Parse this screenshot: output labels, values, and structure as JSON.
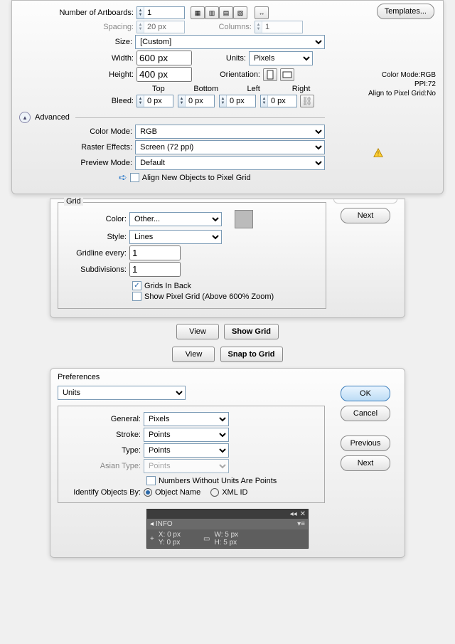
{
  "new_doc": {
    "number_of_artboards_label": "Number of Artboards:",
    "number_of_artboards_value": "1",
    "spacing_label": "Spacing:",
    "spacing_value": "20 px",
    "columns_label": "Columns:",
    "columns_value": "1",
    "size_label": "Size:",
    "size_value": "[Custom]",
    "width_label": "Width:",
    "width_value": "600 px",
    "units_label": "Units:",
    "units_value": "Pixels",
    "height_label": "Height:",
    "height_value": "400 px",
    "orientation_label": "Orientation:",
    "bleed_label": "Bleed:",
    "bleed_top_label": "Top",
    "bleed_bottom_label": "Bottom",
    "bleed_left_label": "Left",
    "bleed_right_label": "Right",
    "bleed_top_value": "0 px",
    "bleed_bottom_value": "0 px",
    "bleed_left_value": "0 px",
    "bleed_right_value": "0 px",
    "advanced_label": "Advanced",
    "color_mode_label": "Color Mode:",
    "color_mode_value": "RGB",
    "raster_effects_label": "Raster Effects:",
    "raster_effects_value": "Screen (72 ppi)",
    "preview_mode_label": "Preview Mode:",
    "preview_mode_value": "Default",
    "align_pixel_grid_label": "Align New Objects to Pixel Grid",
    "templates_btn": "Templates...",
    "side_info_colormode": "Color Mode:RGB",
    "side_info_ppi": "PPI:72",
    "side_info_align": "Align to Pixel Grid:No"
  },
  "grid_panel": {
    "next_btn": "Next",
    "grid_legend": "Grid",
    "color_label": "Color:",
    "color_value": "Other...",
    "style_label": "Style:",
    "style_value": "Lines",
    "gridline_label": "Gridline every:",
    "gridline_value": "1",
    "subdivisions_label": "Subdivisions:",
    "subdivisions_value": "1",
    "grids_back_label": "Grids In Back",
    "show_pixel_grid_label": "Show Pixel Grid (Above 600% Zoom)"
  },
  "menu": {
    "view1": "View",
    "show_grid": "Show Grid",
    "view2": "View",
    "snap_grid": "Snap to Grid"
  },
  "prefs": {
    "title": "Preferences",
    "units_tab": "Units",
    "general_label": "General:",
    "general_value": "Pixels",
    "stroke_label": "Stroke:",
    "stroke_value": "Points",
    "type_label": "Type:",
    "type_value": "Points",
    "asian_label": "Asian Type:",
    "asian_value": "Points",
    "nounits_label": "Numbers Without Units Are Points",
    "identify_label": "Identify Objects By:",
    "opt_object_name": "Object Name",
    "opt_xml_id": "XML ID",
    "ok_btn": "OK",
    "cancel_btn": "Cancel",
    "previous_btn": "Previous",
    "next_btn": "Next"
  },
  "info_panel": {
    "tab": "INFO",
    "x_label": "X",
    "x_value": ": 0 px",
    "y_label": "Y",
    "y_value": ": 0 px",
    "w_label": "W",
    "w_value": ": 5 px",
    "h_label": "H",
    "h_value": ": 5 px"
  }
}
